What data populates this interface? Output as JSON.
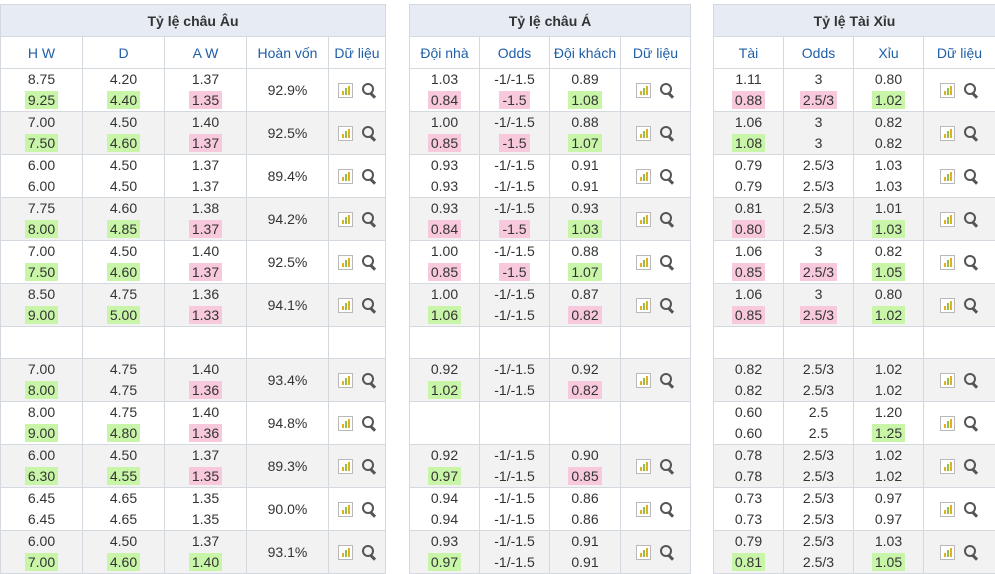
{
  "europe": {
    "title": "Tỷ lệ châu Âu",
    "headers": [
      "H W",
      "D",
      "A W",
      "Hoàn vốn",
      "Dữ liệu"
    ],
    "rows": [
      {
        "hw": [
          "8.75",
          "9.25"
        ],
        "hw_hl": "g",
        "d": [
          "4.20",
          "4.40"
        ],
        "d_hl": "g",
        "aw": [
          "1.37",
          "1.35"
        ],
        "aw_hl": "p",
        "pct": "92.9%"
      },
      {
        "hw": [
          "7.00",
          "7.50"
        ],
        "hw_hl": "g",
        "d": [
          "4.50",
          "4.60"
        ],
        "d_hl": "g",
        "aw": [
          "1.40",
          "1.37"
        ],
        "aw_hl": "p",
        "pct": "92.5%"
      },
      {
        "hw": [
          "6.00",
          "6.00"
        ],
        "hw_hl": "",
        "d": [
          "4.50",
          "4.50"
        ],
        "d_hl": "",
        "aw": [
          "1.37",
          "1.37"
        ],
        "aw_hl": "",
        "pct": "89.4%"
      },
      {
        "hw": [
          "7.75",
          "8.00"
        ],
        "hw_hl": "g",
        "d": [
          "4.60",
          "4.85"
        ],
        "d_hl": "g",
        "aw": [
          "1.38",
          "1.37"
        ],
        "aw_hl": "p",
        "pct": "94.2%"
      },
      {
        "hw": [
          "7.00",
          "7.50"
        ],
        "hw_hl": "g",
        "d": [
          "4.50",
          "4.60"
        ],
        "d_hl": "g",
        "aw": [
          "1.40",
          "1.37"
        ],
        "aw_hl": "p",
        "pct": "92.5%"
      },
      {
        "hw": [
          "8.50",
          "9.00"
        ],
        "hw_hl": "g",
        "d": [
          "4.75",
          "5.00"
        ],
        "d_hl": "g",
        "aw": [
          "1.36",
          "1.33"
        ],
        "aw_hl": "p",
        "pct": "94.1%"
      },
      {
        "gap": true
      },
      {
        "hw": [
          "7.00",
          "8.00"
        ],
        "hw_hl": "g",
        "d": [
          "4.75",
          "4.75"
        ],
        "d_hl": "",
        "aw": [
          "1.40",
          "1.36"
        ],
        "aw_hl": "p",
        "pct": "93.4%"
      },
      {
        "hw": [
          "8.00",
          "9.00"
        ],
        "hw_hl": "g",
        "d": [
          "4.75",
          "4.80"
        ],
        "d_hl": "g",
        "aw": [
          "1.40",
          "1.36"
        ],
        "aw_hl": "p",
        "pct": "94.8%"
      },
      {
        "hw": [
          "6.00",
          "6.30"
        ],
        "hw_hl": "g",
        "d": [
          "4.50",
          "4.55"
        ],
        "d_hl": "g",
        "aw": [
          "1.37",
          "1.35"
        ],
        "aw_hl": "p",
        "pct": "89.3%"
      },
      {
        "hw": [
          "6.45",
          "6.45"
        ],
        "hw_hl": "",
        "d": [
          "4.65",
          "4.65"
        ],
        "d_hl": "",
        "aw": [
          "1.35",
          "1.35"
        ],
        "aw_hl": "",
        "pct": "90.0%"
      },
      {
        "hw": [
          "6.00",
          "7.00"
        ],
        "hw_hl": "g",
        "d": [
          "4.50",
          "4.60"
        ],
        "d_hl": "g",
        "aw": [
          "1.37",
          "1.40"
        ],
        "aw_hl": "g",
        "pct": "93.1%"
      }
    ]
  },
  "asia": {
    "title": "Tỷ lệ châu Á",
    "headers": [
      "Đội nhà",
      "Odds",
      "Đội khách",
      "Dữ liệu"
    ],
    "rows": [
      {
        "a": [
          "1.03",
          "0.84"
        ],
        "a_hl": "p",
        "b": [
          "-1/-1.5",
          "-1.5"
        ],
        "b_hl": "p",
        "c": [
          "0.89",
          "1.08"
        ],
        "c_hl": "g"
      },
      {
        "a": [
          "1.00",
          "0.85"
        ],
        "a_hl": "p",
        "b": [
          "-1/-1.5",
          "-1.5"
        ],
        "b_hl": "p",
        "c": [
          "0.88",
          "1.07"
        ],
        "c_hl": "g"
      },
      {
        "a": [
          "0.93",
          "0.93"
        ],
        "a_hl": "",
        "b": [
          "-1/-1.5",
          "-1/-1.5"
        ],
        "b_hl": "",
        "c": [
          "0.91",
          "0.91"
        ],
        "c_hl": ""
      },
      {
        "a": [
          "0.93",
          "0.84"
        ],
        "a_hl": "p",
        "b": [
          "-1/-1.5",
          "-1.5"
        ],
        "b_hl": "p",
        "c": [
          "0.93",
          "1.03"
        ],
        "c_hl": "g"
      },
      {
        "a": [
          "1.00",
          "0.85"
        ],
        "a_hl": "p",
        "b": [
          "-1/-1.5",
          "-1.5"
        ],
        "b_hl": "p",
        "c": [
          "0.88",
          "1.07"
        ],
        "c_hl": "g"
      },
      {
        "a": [
          "1.00",
          "1.06"
        ],
        "a_hl": "g",
        "b": [
          "-1/-1.5",
          "-1/-1.5"
        ],
        "b_hl": "",
        "c": [
          "0.87",
          "0.82"
        ],
        "c_hl": "p"
      },
      {
        "gap": true
      },
      {
        "a": [
          "0.92",
          "1.02"
        ],
        "a_hl": "g",
        "b": [
          "-1/-1.5",
          "-1/-1.5"
        ],
        "b_hl": "",
        "c": [
          "0.92",
          "0.82"
        ],
        "c_hl": "p"
      },
      {
        "empty": true
      },
      {
        "a": [
          "0.92",
          "0.97"
        ],
        "a_hl": "g",
        "b": [
          "-1/-1.5",
          "-1/-1.5"
        ],
        "b_hl": "",
        "c": [
          "0.90",
          "0.85"
        ],
        "c_hl": "p"
      },
      {
        "a": [
          "0.94",
          "0.94"
        ],
        "a_hl": "",
        "b": [
          "-1/-1.5",
          "-1/-1.5"
        ],
        "b_hl": "",
        "c": [
          "0.86",
          "0.86"
        ],
        "c_hl": ""
      },
      {
        "a": [
          "0.93",
          "0.97"
        ],
        "a_hl": "g",
        "b": [
          "-1/-1.5",
          "-1/-1.5"
        ],
        "b_hl": "",
        "c": [
          "0.91",
          "0.91"
        ],
        "c_hl": ""
      }
    ]
  },
  "taixiu": {
    "title": "Tỷ lệ Tài Xỉu",
    "headers": [
      "Tài",
      "Odds",
      "Xỉu",
      "Dữ liệu"
    ],
    "rows": [
      {
        "a": [
          "1.11",
          "0.88"
        ],
        "a_hl": "p",
        "b": [
          "3",
          "2.5/3"
        ],
        "b_hl": "p",
        "c": [
          "0.80",
          "1.02"
        ],
        "c_hl": "g"
      },
      {
        "a": [
          "1.06",
          "1.08"
        ],
        "a_hl": "g",
        "b": [
          "3",
          "3"
        ],
        "b_hl": "",
        "c": [
          "0.82",
          "0.82"
        ],
        "c_hl": ""
      },
      {
        "a": [
          "0.79",
          "0.79"
        ],
        "a_hl": "",
        "b": [
          "2.5/3",
          "2.5/3"
        ],
        "b_hl": "",
        "c": [
          "1.03",
          "1.03"
        ],
        "c_hl": ""
      },
      {
        "a": [
          "0.81",
          "0.80"
        ],
        "a_hl": "p",
        "b": [
          "2.5/3",
          "2.5/3"
        ],
        "b_hl": "",
        "c": [
          "1.01",
          "1.03"
        ],
        "c_hl": "g"
      },
      {
        "a": [
          "1.06",
          "0.85"
        ],
        "a_hl": "p",
        "b": [
          "3",
          "2.5/3"
        ],
        "b_hl": "p",
        "c": [
          "0.82",
          "1.05"
        ],
        "c_hl": "g"
      },
      {
        "a": [
          "1.06",
          "0.85"
        ],
        "a_hl": "p",
        "b": [
          "3",
          "2.5/3"
        ],
        "b_hl": "p",
        "c": [
          "0.80",
          "1.02"
        ],
        "c_hl": "g"
      },
      {
        "gap": true
      },
      {
        "a": [
          "0.82",
          "0.82"
        ],
        "a_hl": "",
        "b": [
          "2.5/3",
          "2.5/3"
        ],
        "b_hl": "",
        "c": [
          "1.02",
          "1.02"
        ],
        "c_hl": ""
      },
      {
        "a": [
          "0.60",
          "0.60"
        ],
        "a_hl": "",
        "b": [
          "2.5",
          "2.5"
        ],
        "b_hl": "",
        "c": [
          "1.20",
          "1.25"
        ],
        "c_hl": "g"
      },
      {
        "a": [
          "0.78",
          "0.78"
        ],
        "a_hl": "",
        "b": [
          "2.5/3",
          "2.5/3"
        ],
        "b_hl": "",
        "c": [
          "1.02",
          "1.02"
        ],
        "c_hl": ""
      },
      {
        "a": [
          "0.73",
          "0.73"
        ],
        "a_hl": "",
        "b": [
          "2.5/3",
          "2.5/3"
        ],
        "b_hl": "",
        "c": [
          "0.97",
          "0.97"
        ],
        "c_hl": ""
      },
      {
        "a": [
          "0.79",
          "0.81"
        ],
        "a_hl": "g",
        "b": [
          "2.5/3",
          "2.5/3"
        ],
        "b_hl": "",
        "c": [
          "1.03",
          "1.05"
        ],
        "c_hl": "g"
      }
    ]
  },
  "colors": {
    "highlight_up": "#c8f5a8",
    "highlight_down": "#f8c9dc",
    "header_bg": "#e7ecf4",
    "header_text": "#1f5fa8"
  },
  "icons": {
    "chart": "bar-chart-icon",
    "search": "search-icon"
  }
}
